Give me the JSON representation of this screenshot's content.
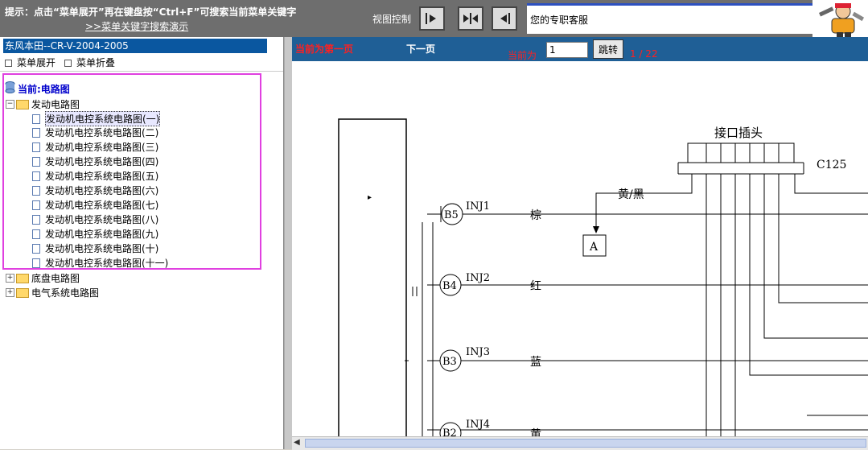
{
  "top": {
    "hint": "提示：点击“菜单展开”再在键盘按“Ctrl+F”可搜索当前菜单关键字",
    "hint_link": ">>菜单关键字搜索演示",
    "view_label": "视图控制",
    "customer_service": "您的专职客服"
  },
  "left": {
    "title": "东风本田--CR-V-2004-2005",
    "expand": "菜单展开",
    "collapse": "菜单折叠",
    "current": "当前:电路图",
    "tree": [
      {
        "label": "发动电路图",
        "expanded": true,
        "children": [
          "发动机电控系统电路图(一)",
          "发动机电控系统电路图(二)",
          "发动机电控系统电路图(三)",
          "发动机电控系统电路图(四)",
          "发动机电控系统电路图(五)",
          "发动机电控系统电路图(六)",
          "发动机电控系统电路图(七)",
          "发动机电控系统电路图(八)",
          "发动机电控系统电路图(九)",
          "发动机电控系统电路图(十)",
          "发动机电控系统电路图(十一)"
        ]
      },
      {
        "label": "底盘电路图",
        "expanded": false
      },
      {
        "label": "电气系统电路图",
        "expanded": false
      }
    ]
  },
  "nav": {
    "first": "当前为第一页",
    "next": "下一页",
    "current_label": "当前为",
    "page_value": "1",
    "jump": "跳转",
    "page_count": "1 / 22"
  },
  "diagram": {
    "connector_title": "接口插头",
    "connector_id": "C125",
    "wire_top": "黄/黑",
    "box_label": "A",
    "rows": [
      {
        "pin": "B5",
        "name": "INJ1",
        "color": "棕"
      },
      {
        "pin": "B4",
        "name": "INJ2",
        "color": "红"
      },
      {
        "pin": "B3",
        "name": "INJ3",
        "color": "蓝"
      },
      {
        "pin": "B2",
        "name": "INJ4",
        "color": "黄"
      }
    ]
  }
}
